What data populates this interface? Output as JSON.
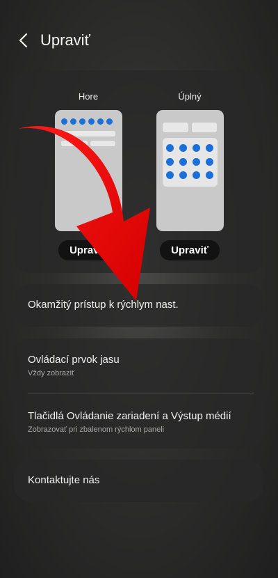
{
  "header": {
    "title": "Upraviť"
  },
  "layout": {
    "options": [
      {
        "label": "Hore",
        "button": "Upraviť"
      },
      {
        "label": "Úplný",
        "button": "Upraviť"
      }
    ]
  },
  "settings": {
    "instant_access": "Okamžitý prístup k rýchlym nast.",
    "brightness": {
      "title": "Ovládací prvok jasu",
      "subtitle": "Vždy zobraziť"
    },
    "device_controls": {
      "title": "Tlačidlá Ovládanie zariadení a Výstup médií",
      "subtitle": "Zobrazovať pri zbalenom rýchlom paneli"
    },
    "contact": "Kontaktujte nás"
  },
  "colors": {
    "accent_dot": "#1b6fd8",
    "overlay_arrow": "#e60000"
  }
}
